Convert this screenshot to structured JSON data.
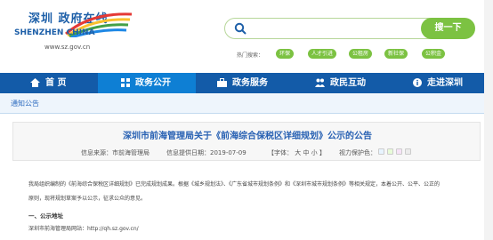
{
  "header": {
    "logo_cn": "深圳 政府在线",
    "logo_en": "SHENZHEN CHINA",
    "logo_url": "www.sz.gov.cn",
    "search_placeholder": "",
    "search_button": "搜一下",
    "hot_label": "热门搜索：",
    "hot_items": [
      "环保",
      "人才引进",
      "公租房",
      "新社保",
      "公积金"
    ]
  },
  "nav": {
    "items": [
      "首 页",
      "政务公开",
      "政务服务",
      "政民互动",
      "走进深圳"
    ]
  },
  "breadcrumb": "通知公告",
  "article": {
    "title": "深圳市前海管理局关于《前海综合保税区详细规划》公示的公告",
    "source": "信息来源：市前海管理局",
    "date": "信息提供日期：2019-07-09",
    "font_label": "【字体： 大  中  小 】",
    "color_label": "视力保护色：",
    "colors": [
      "#e8f4ff",
      "#e8fbd8",
      "#f6e3f7",
      "#ececec"
    ],
    "para1": "我局组织编制的《前海综合保税区详细规划》已完成规划成果。根据《城乡规划法》、《广东省城市规划条例》和《深圳市城市规划条例》等相关规定，本着公开、公平、公正的",
    "para2": "原则，现将规划草案予以公示，征求公众的意见。",
    "section1": "一、公示地址",
    "site": "深圳市前海管理局网站：http://qh.sz.gov.cn/"
  }
}
